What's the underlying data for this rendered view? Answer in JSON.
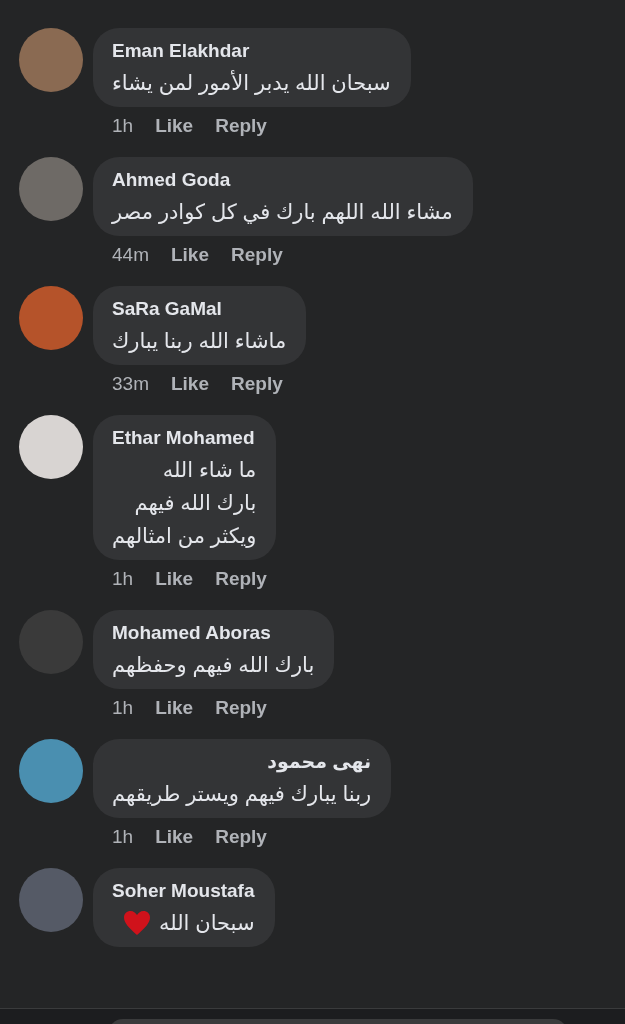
{
  "comments": [
    {
      "author": "Eman Elakhdar",
      "lines": [
        "سبحان الله يدبر الأمور لمن يشاء"
      ],
      "time": "1h",
      "like": "Like",
      "reply": "Reply",
      "heart": false
    },
    {
      "author": "Ahmed Goda",
      "lines": [
        "مشاء الله اللهم بارك في كل كوادر مصر"
      ],
      "time": "44m",
      "like": "Like",
      "reply": "Reply",
      "heart": false
    },
    {
      "author": "SaRa GaMal",
      "lines": [
        "ماشاء الله ربنا يبارك"
      ],
      "time": "33m",
      "like": "Like",
      "reply": "Reply",
      "heart": false
    },
    {
      "author": "Ethar Mohamed",
      "lines": [
        "ما شاء الله",
        "بارك الله فيهم",
        "ويكثر من امثالهم"
      ],
      "time": "1h",
      "like": "Like",
      "reply": "Reply",
      "heart": false
    },
    {
      "author": "Mohamed Aboras",
      "lines": [
        "بارك الله فيهم وحفظهم"
      ],
      "time": "1h",
      "like": "Like",
      "reply": "Reply",
      "heart": false
    },
    {
      "author": "نهى محمود",
      "lines": [
        "ربنا يبارك فيهم ويستر طريقهم"
      ],
      "time": "1h",
      "like": "Like",
      "reply": "Reply",
      "heart": false
    },
    {
      "author": "Soher Moustafa",
      "lines": [
        "سبحان الله"
      ],
      "heart": true
    }
  ]
}
